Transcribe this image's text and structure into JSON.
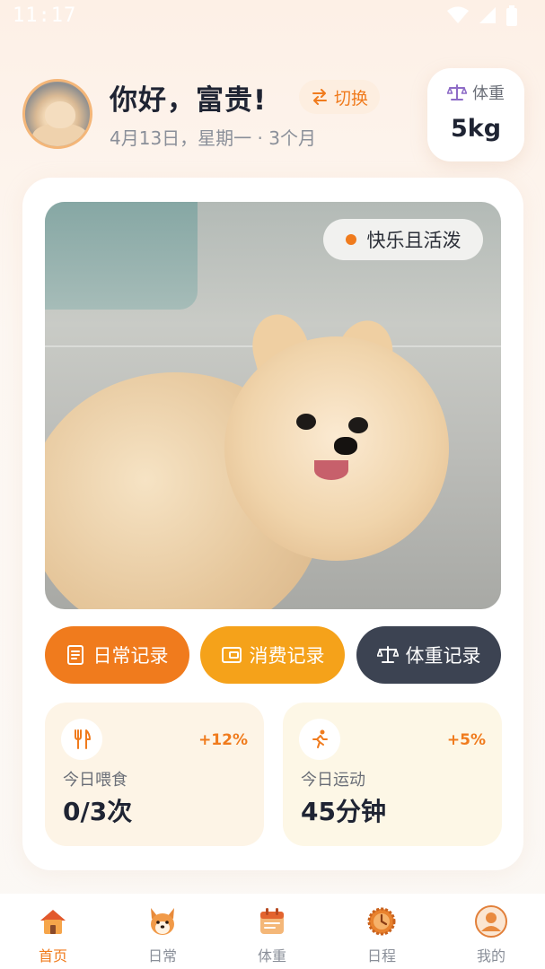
{
  "status_bar": {
    "time": "11:17"
  },
  "header": {
    "greeting": "你好，富贵!",
    "switch_label": "切换",
    "date_line": "4月13日，星期一 · 3个月",
    "weight_card": {
      "label": "体重",
      "value": "5kg"
    }
  },
  "pet_photo": {
    "mood": "快乐且活泼"
  },
  "actions": {
    "daily": "日常记录",
    "spending": "消费记录",
    "weight": "体重记录"
  },
  "stats": {
    "feeding": {
      "label": "今日喂食",
      "value": "0/3次",
      "delta": "+12%"
    },
    "exercise": {
      "label": "今日运动",
      "value": "45分钟",
      "delta": "+5%"
    }
  },
  "bottom_nav": {
    "items": [
      {
        "label": "首页",
        "icon": "home-icon",
        "active": true
      },
      {
        "label": "日常",
        "icon": "corgi-icon",
        "active": false
      },
      {
        "label": "体重",
        "icon": "calendar-icon",
        "active": false
      },
      {
        "label": "日程",
        "icon": "schedule-clock-icon",
        "active": false
      },
      {
        "label": "我的",
        "icon": "profile-icon",
        "active": false
      }
    ]
  },
  "colors": {
    "accent": "#f07b1d",
    "amber": "#f5a21a",
    "slate": "#3c4352"
  }
}
